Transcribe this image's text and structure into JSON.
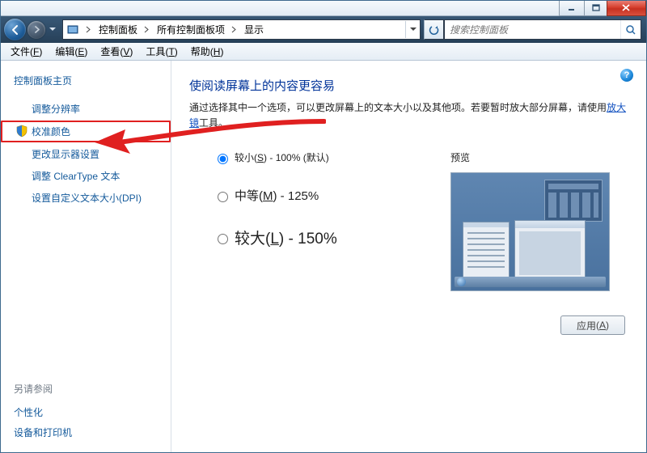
{
  "titlebar": {
    "minimize": "–",
    "maximize": "□",
    "close": "×"
  },
  "nav": {
    "breadcrumb": [
      "控制面板",
      "所有控制面板项",
      "显示"
    ],
    "search_placeholder": "搜索控制面板"
  },
  "menu": {
    "file": "文件",
    "file_u": "F",
    "edit": "编辑",
    "edit_u": "E",
    "view": "查看",
    "view_u": "V",
    "tools": "工具",
    "tools_u": "T",
    "help": "帮助",
    "help_u": "H"
  },
  "sidebar": {
    "home": "控制面板主页",
    "links": {
      "resolution": "调整分辨率",
      "calibrate": "校准颜色",
      "display_settings": "更改显示器设置",
      "cleartype": "调整 ClearType 文本",
      "dpi": "设置自定义文本大小(DPI)"
    },
    "see_also": "另请参阅",
    "personalization": "个性化",
    "devices": "设备和打印机"
  },
  "content": {
    "heading": "使阅读屏幕上的内容更容易",
    "desc_pre": "通过选择其中一个选项，可以更改屏幕上的文本大小以及其他项。若要暂时放大部分屏幕，请使用",
    "desc_link": "放大镜",
    "desc_post": "工具。",
    "options": {
      "small_label": "较小",
      "small_u": "S",
      "small_suffix": " - 100% (默认)",
      "medium_label": "中等",
      "medium_u": "M",
      "medium_suffix": " - 125%",
      "large_label": "较大",
      "large_u": "L",
      "large_suffix": " - 150%",
      "selected": "small"
    },
    "preview_title": "预览",
    "apply_label": "应用",
    "apply_u": "A"
  },
  "help_tooltip": "?"
}
